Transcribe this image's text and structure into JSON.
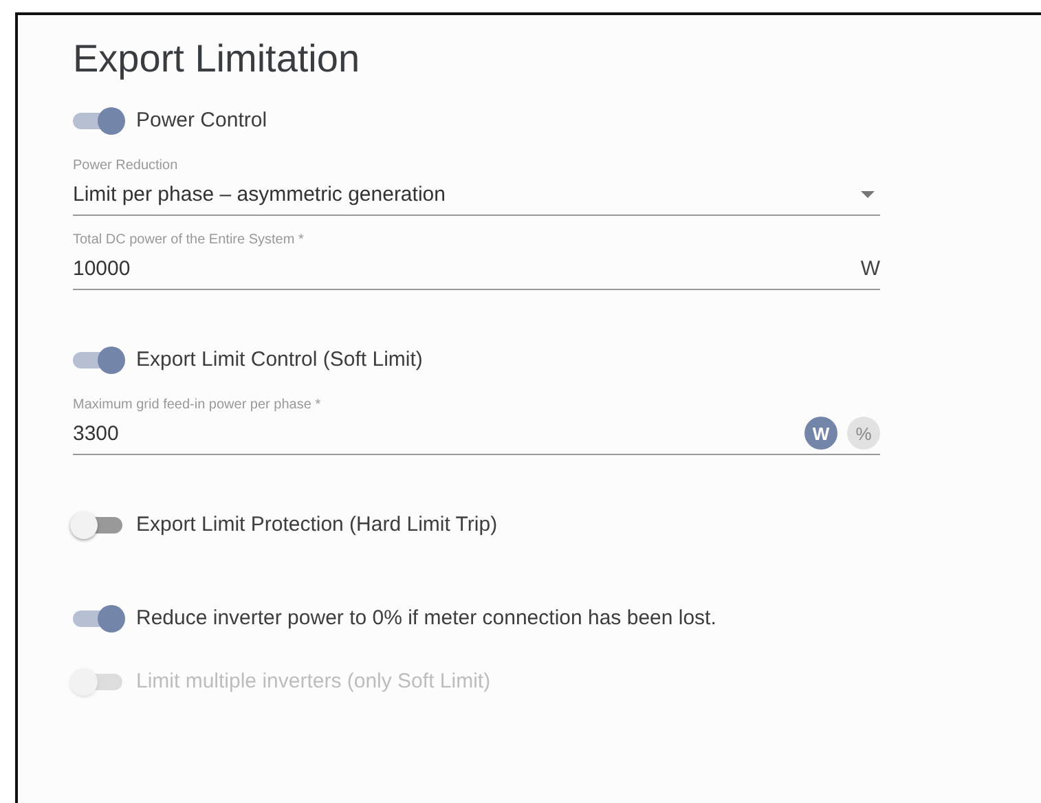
{
  "title": "Export Limitation",
  "items": [
    {
      "kind": "toggle",
      "label": "Power Control",
      "on": true,
      "disabled": false
    },
    {
      "kind": "select",
      "label": "Power Reduction",
      "value": "Limit per phase – asymmetric generation"
    },
    {
      "kind": "field",
      "label": "Total DC power of the Entire System *",
      "value": "10000",
      "suffix": "W"
    },
    {
      "kind": "toggle",
      "label": "Export Limit Control (Soft Limit)",
      "on": true,
      "disabled": false
    },
    {
      "kind": "field",
      "label": "Maximum grid feed-in power per phase *",
      "value": "3300",
      "units": [
        {
          "label": "W",
          "selected": true
        },
        {
          "label": "%",
          "selected": false
        }
      ]
    },
    {
      "kind": "toggle",
      "label": "Export Limit Protection (Hard Limit Trip)",
      "on": false,
      "disabled": false
    },
    {
      "kind": "toggle",
      "label": "Reduce inverter power to 0% if meter connection has been lost.",
      "on": true,
      "disabled": false
    },
    {
      "kind": "toggle",
      "label": "Limit multiple inverters (only Soft Limit)",
      "on": false,
      "disabled": true
    }
  ]
}
